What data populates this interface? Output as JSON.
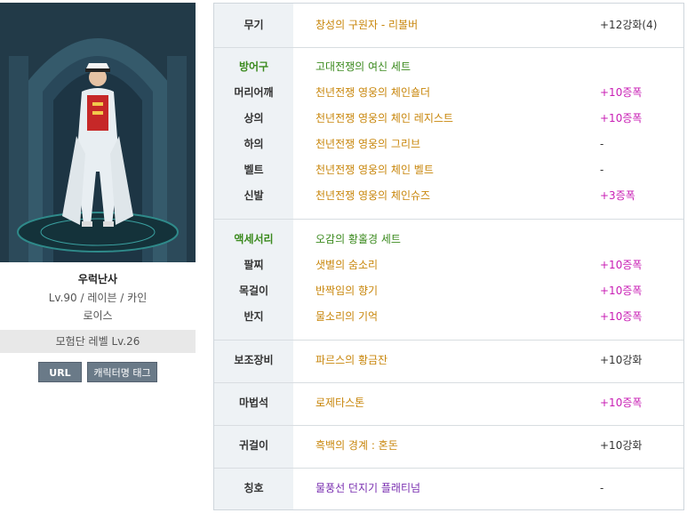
{
  "character": {
    "name": "우럭난사",
    "info": "Lv.90 / 레이븐 / 카인",
    "guild": "로이스",
    "adventure_level": "모험단 레벨 Lv.26"
  },
  "buttons": {
    "url": "URL",
    "tag": "캐릭터명 태그"
  },
  "equipment": {
    "weapon": {
      "label": "무기",
      "item": "창성의 구원자 - 리볼버",
      "value": "+12강화(4)"
    },
    "armor": {
      "label": "방어구",
      "set": "고대전쟁의 여신 세트",
      "rows": [
        {
          "label": "머리어깨",
          "item": "천년전쟁 영웅의 체인숄더",
          "value": "+10증폭"
        },
        {
          "label": "상의",
          "item": "천년전쟁 영웅의 체인 레지스트",
          "value": "+10증폭"
        },
        {
          "label": "하의",
          "item": "천년전쟁 영웅의 그리브",
          "value": "-"
        },
        {
          "label": "벨트",
          "item": "천년전쟁 영웅의 체인 벨트",
          "value": "-"
        },
        {
          "label": "신발",
          "item": "천년전쟁 영웅의 체인슈즈",
          "value": "+3증폭"
        }
      ]
    },
    "accessory": {
      "label": "액세서리",
      "set": "오감의 황홀경 세트",
      "rows": [
        {
          "label": "팔찌",
          "item": "샛별의 숨소리",
          "value": "+10증폭"
        },
        {
          "label": "목걸이",
          "item": "반짝임의 향기",
          "value": "+10증폭"
        },
        {
          "label": "반지",
          "item": "물소리의 기억",
          "value": "+10증폭"
        }
      ]
    },
    "sub": {
      "label": "보조장비",
      "item": "파르스의 황금잔",
      "value": "+10강화"
    },
    "magicstone": {
      "label": "마법석",
      "item": "로제타스톤",
      "value": "+10증폭"
    },
    "earring": {
      "label": "귀걸이",
      "item": "흑백의 경계 : 혼돈",
      "value": "+10강화"
    },
    "title": {
      "label": "칭호",
      "item": "물풍선 던지기 플래티넘",
      "value": "-"
    }
  },
  "colors": {
    "item_orange": "#c8860b",
    "set_green": "#3b8a1e",
    "amp_magenta": "#c81eb4",
    "title_purple": "#7a2fb0",
    "label_bg": "#eef2f5",
    "button_bg": "#6a7a88"
  }
}
